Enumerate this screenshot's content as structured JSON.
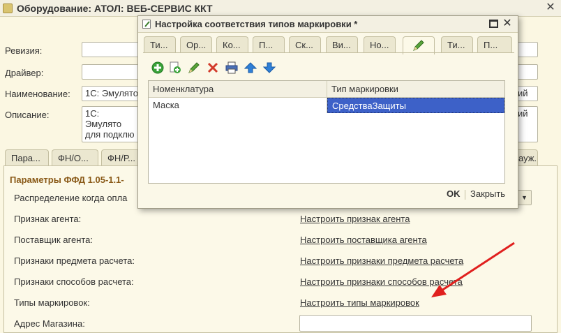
{
  "window": {
    "title": "Оборудование: АТОЛ: ВЕБ-СЕРВИС ККТ",
    "close_symbol": "✕"
  },
  "fields": {
    "revision_label": "Ревизия:",
    "driver_label": "Драйвер:",
    "name_label": "Наименование:",
    "name_value": "1С: Эмулято",
    "name_tail": "ий",
    "description_label": "Описание:",
    "description_value": "1С: Эмулято для подклю",
    "description_tail": "ий"
  },
  "main_tabs": [
    {
      "label": "Пара..."
    },
    {
      "label": "ФН/О..."
    },
    {
      "label": "ФН/Р..."
    },
    {
      "label": "ауж..."
    }
  ],
  "section": {
    "title": "Параметры ФФД 1.05-1.1-",
    "rows": [
      {
        "label": "Распределение когда опла",
        "link": ""
      },
      {
        "label": "Признак агента:",
        "link": "Настроить признак агента"
      },
      {
        "label": "Поставщик агента:",
        "link": "Настроить поставщика агента"
      },
      {
        "label": "Признаки предмета расчета:",
        "link": "Настроить признаки предмета расчета"
      },
      {
        "label": "Признаки способов расчета:",
        "link": "Настроить признаки способов расчета"
      },
      {
        "label": "Типы маркировок:",
        "link": "Настроить типы маркировок"
      },
      {
        "label": "Адрес Магазина:",
        "link": ""
      }
    ]
  },
  "dialog": {
    "title": "Настройка соответствия типов маркировки *",
    "tabs": [
      {
        "label": "Ти..."
      },
      {
        "label": "Ор..."
      },
      {
        "label": "Ко..."
      },
      {
        "label": "П..."
      },
      {
        "label": "Ск..."
      },
      {
        "label": "Ви..."
      },
      {
        "label": "Но..."
      },
      {
        "label": "",
        "icon": "pencil-icon"
      },
      {
        "label": "Ти..."
      },
      {
        "label": "П..."
      }
    ],
    "toolbar": [
      "add-icon",
      "copy-add-icon",
      "edit-pencil-icon",
      "delete-icon",
      "print-icon",
      "move-up-icon",
      "move-down-icon"
    ],
    "grid": {
      "columns": [
        "Номенклатура",
        "Тип маркировки"
      ],
      "rows": [
        {
          "nomenclature": "Маска",
          "marking_type": "СредстваЗащиты"
        }
      ]
    },
    "ok_label": "OK",
    "close_label": "Закрыть",
    "close_symbol": "✕"
  },
  "colors": {
    "background": "#fbf7e2",
    "section_title": "#8a5a18",
    "selection": "#3d61c8",
    "arrow": "#e0201e"
  }
}
